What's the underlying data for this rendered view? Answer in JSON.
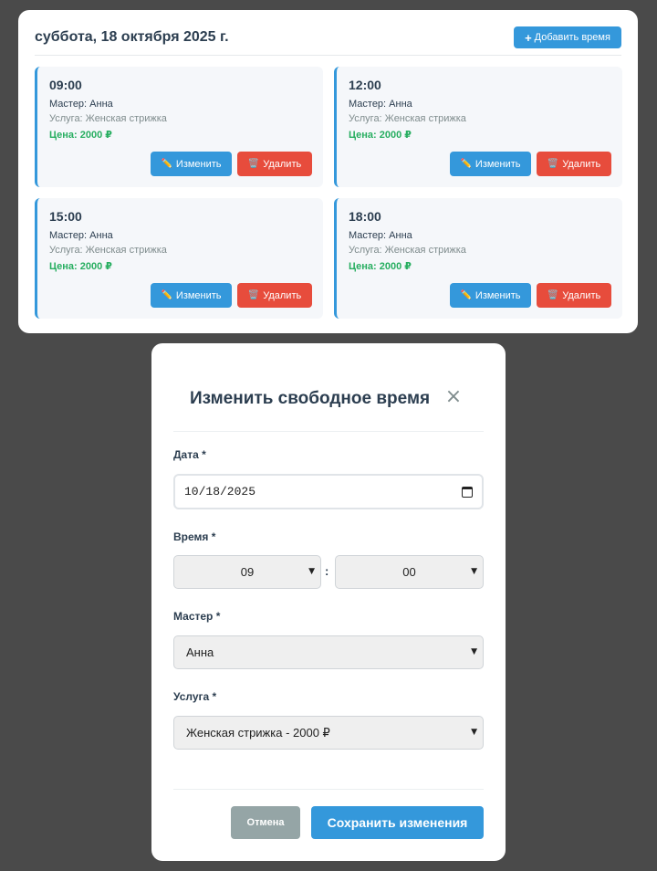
{
  "schedule": {
    "date": "суббота, 18 октября 2025 г.",
    "add_button": "Добавить время",
    "slots": [
      {
        "time": "09:00",
        "master": "Мастер: Анна",
        "service": "Услуга: Женская стрижка",
        "price": "Цена: 2000 ₽",
        "edit": "Изменить",
        "delete": "Удалить"
      },
      {
        "time": "12:00",
        "master": "Мастер: Анна",
        "service": "Услуга: Женская стрижка",
        "price": "Цена: 2000 ₽",
        "edit": "Изменить",
        "delete": "Удалить"
      },
      {
        "time": "15:00",
        "master": "Мастер: Анна",
        "service": "Услуга: Женская стрижка",
        "price": "Цена: 2000 ₽",
        "edit": "Изменить",
        "delete": "Удалить"
      },
      {
        "time": "18:00",
        "master": "Мастер: Анна",
        "service": "Услуга: Женская стрижка",
        "price": "Цена: 2000 ₽",
        "edit": "Изменить",
        "delete": "Удалить"
      }
    ]
  },
  "modal": {
    "title": "Изменить свободное время",
    "close_symbol": "×",
    "date_label": "Дата *",
    "date_value": "10/18/2025",
    "time_label": "Время *",
    "hour_value": "09",
    "minute_value": "00",
    "time_separator": ":",
    "master_label": "Мастер *",
    "master_value": "Анна",
    "service_label": "Услуга *",
    "service_value": "Женская стрижка - 2000 ₽",
    "cancel_button": "Отмена",
    "save_button": "Сохранить изменения"
  },
  "icons": {
    "add": "plus-icon",
    "edit": "pencil-icon",
    "delete": "trash-icon",
    "close": "close-icon",
    "date": "calendar-icon",
    "select": "chevron-down-icon"
  },
  "colors": {
    "primary": "#3498db",
    "danger": "#e74c3c",
    "price": "#27ae60",
    "secondary": "#95a5a6",
    "overlay": "#4a4a4a"
  }
}
